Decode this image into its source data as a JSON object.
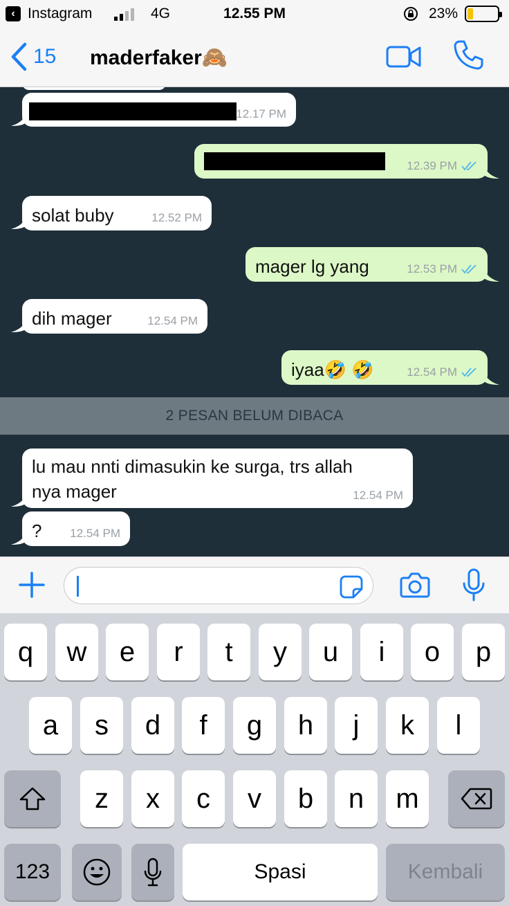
{
  "status_bar": {
    "back_app": "Instagram",
    "network": "4G",
    "time": "12.55 PM",
    "battery": "23%",
    "battery_level": 0.23
  },
  "nav": {
    "back_count": "15",
    "title": "maderfaker🙈"
  },
  "messages": [
    {
      "dir": "in",
      "text": "",
      "time": "12.17 PM",
      "redacted": true
    },
    {
      "dir": "out",
      "text": "",
      "time": "12.39 PM",
      "redacted": true,
      "read": true
    },
    {
      "dir": "in",
      "text": "solat buby",
      "time": "12.52 PM"
    },
    {
      "dir": "out",
      "text": "mager lg yang",
      "time": "12.53 PM",
      "read": true
    },
    {
      "dir": "in",
      "text": "dih mager",
      "time": "12.54 PM"
    },
    {
      "dir": "out",
      "text": "iyaa🤣 🤣",
      "time": "12.54 PM",
      "read": true
    },
    {
      "dir": "in",
      "text_line1": "lu mau nnti dimasukin ke surga, trs allah",
      "text_line2": "nya mager",
      "time": "12.54 PM"
    },
    {
      "dir": "in",
      "text": "?",
      "time": "12.54 PM"
    }
  ],
  "unread_banner": "2 PESAN BELUM DIBACA",
  "input": {
    "value": ""
  },
  "keyboard": {
    "row1": [
      "q",
      "w",
      "e",
      "r",
      "t",
      "y",
      "u",
      "i",
      "o",
      "p"
    ],
    "row2": [
      "a",
      "s",
      "d",
      "f",
      "g",
      "h",
      "j",
      "k",
      "l"
    ],
    "row3": [
      "z",
      "x",
      "c",
      "v",
      "b",
      "n",
      "m"
    ],
    "numbers_key": "123",
    "space_key": "Spasi",
    "return_key": "Kembali"
  },
  "colors": {
    "accent": "#1a7ff5",
    "chat_background": "#1e2f3a",
    "outgoing_bubble": "#dcf8c6",
    "incoming_bubble": "#ffffff",
    "read_ticks": "#4fb6ec",
    "battery_fill": "#f5c400"
  },
  "icons": {
    "back": "chevron-left-icon",
    "video": "video-camera-icon",
    "call": "phone-icon",
    "add": "plus-icon",
    "sticker": "sticker-icon",
    "camera": "camera-icon",
    "mic": "microphone-icon",
    "shift": "shift-icon",
    "delete": "backspace-icon",
    "emoji": "emoji-icon",
    "dictation": "microphone-icon"
  }
}
